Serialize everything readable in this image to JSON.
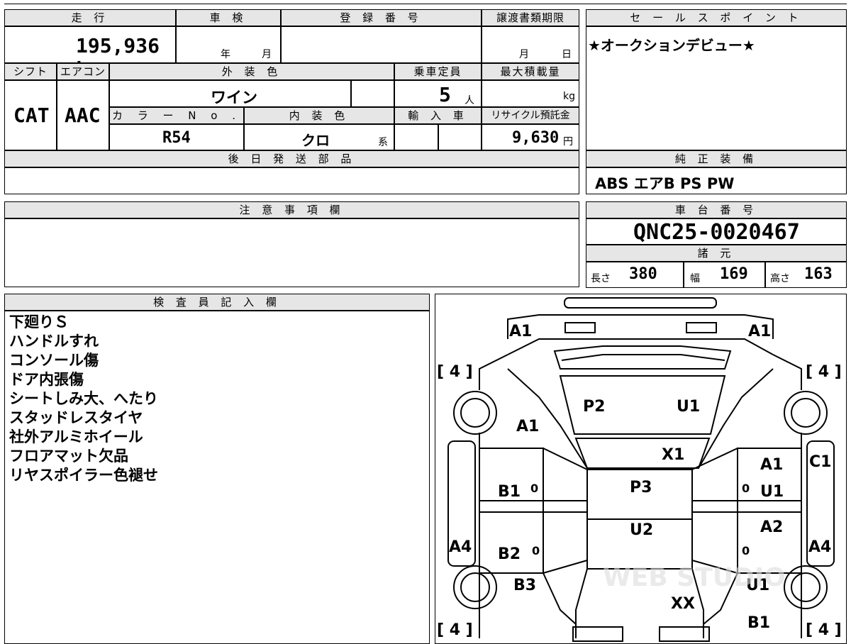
{
  "headers": {
    "mileage": "走 行",
    "inspection": "車 検",
    "registration": "登 録 番 号",
    "transfer_deadline": "譲渡書類期限",
    "sales_point": "セ ー ル ス ポ イ ン ト",
    "shift": "シフト",
    "aircon": "エアコン",
    "exterior_color": "外 装 色",
    "capacity": "乗車定員",
    "max_load": "最大積載量",
    "color_no": "カ ラ ー N o .",
    "interior_color": "内 装 色",
    "import": "輸 入 車",
    "recycle": "リサイクル預託金",
    "later_parts": "後 日 発 送 部 品",
    "genuine_equipment": "純 正 装 備",
    "notes": "注 意 事 項 欄",
    "chassis_no": "車 台 番 号",
    "specs": "諸 元",
    "inspector": "検 査 員 記 入 欄"
  },
  "values": {
    "mileage": "195,936 km",
    "inspection_year": "年",
    "inspection_month": "月",
    "deadline_month": "月",
    "deadline_day": "日",
    "sales_point": "★オークションデビュー★",
    "shift": "CAT",
    "aircon": "AAC",
    "exterior_color": "ワイン",
    "capacity": "5",
    "capacity_unit": "人",
    "load_unit": "kg",
    "color_no": "R54",
    "interior_color": "クロ",
    "interior_suffix": "系",
    "recycle_fee": "9,630",
    "yen": "円",
    "genuine_equipment": "ABS エアB PS PW",
    "chassis_no": "QNC25-0020467",
    "length_label": "長さ",
    "length": "380",
    "width_label": "幅",
    "width": "169",
    "height_label": "高さ",
    "height": "163"
  },
  "inspector_notes": [
    "下廻りＳ",
    "ハンドルすれ",
    "コンソール傷",
    "ドア内張傷",
    "シートしみ大、へたり",
    "スタッドレスタイヤ",
    "社外アルミホイール",
    "フロアマット欠品",
    "リヤスポイラー色褪せ"
  ],
  "diagram_marks": {
    "a1_front_left": "A1",
    "a1_front_right": "A1",
    "tire_fl": "[ 4 ]",
    "tire_fr": "[ 4 ]",
    "tire_rl": "[ 4 ]",
    "tire_rr": "[ 4 ]",
    "p2": "P2",
    "u1_roof": "U1",
    "a1_left_fender": "A1",
    "x1": "X1",
    "a1_right_door": "A1",
    "c1_right": "C1",
    "b1_left": "B1",
    "zero_l1": "0",
    "p3": "P3",
    "zero_r1": "0",
    "u1_right_door": "U1",
    "u2": "U2",
    "a2_right": "A2",
    "a4_left": "A4",
    "b2_left": "B2",
    "zero_l2": "0",
    "zero_r2": "0",
    "a4_right": "A4",
    "b3_left": "B3",
    "u1_right_rear": "U1",
    "xx": "XX",
    "b1_right_rear": "B1",
    "watermark": "WEB STUDIO"
  }
}
